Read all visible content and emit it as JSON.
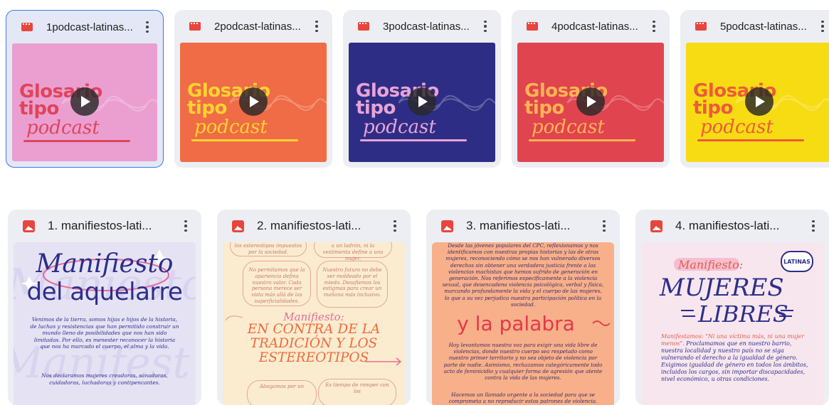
{
  "videos": [
    {
      "title": "1podcast-latinas...",
      "bg": "#ea9fd0",
      "title_color": "#e0445a",
      "podcast_color": "#e0445a",
      "line_color": "#e0445a",
      "selected": true
    },
    {
      "title": "2podcast-latinas...",
      "bg": "#ef6c46",
      "title_color": "#ffd330",
      "podcast_color": "#ffd330",
      "line_color": "#ffd330",
      "selected": false
    },
    {
      "title": "3podcast-latinas...",
      "bg": "#2e2d85",
      "title_color": "#e8a4d6",
      "podcast_color": "#e8a4d6",
      "line_color": "#e8a4d6",
      "selected": false
    },
    {
      "title": "4podcast-latinas...",
      "bg": "#e0444e",
      "title_color": "#ffb454",
      "podcast_color": "#ffb454",
      "line_color": "#ffb454",
      "selected": false
    },
    {
      "title": "5podcast-latinas...",
      "bg": "#f7dc13",
      "title_color": "#ee5a3a",
      "podcast_color": "#ee5a3a",
      "line_color": "#ee5a3a",
      "selected": false
    }
  ],
  "thumbnail_text": {
    "line1": "Glosario",
    "line2": "tipo",
    "line3": "podcast"
  },
  "images": [
    {
      "title": "1. manifiestos-lati...",
      "bg": "#e5e2f4",
      "heading1": "Manifiesto",
      "heading2": "del aquelarre",
      "para1": "Venimos de la tierra, somos hijas e hijos de la historia, de luchas y resistencias que han permitido construir un mundo lleno de posibilidades que nos han sido limitadas. Por ello, es menester reconocer la historia que nos ha marcado el cuerpo, el alma y la vida.",
      "para2": "Nos declaramos mujeres creadoras, sanadoras, cuidadoras, luchadoras y contipencantes."
    },
    {
      "title": "2. manifiestos-lati...",
      "bg": "#fbeccf",
      "bubble1": "los estereotipos impuestos por la sociedad.",
      "bubble2": "a un ladrón, ni la vestimenta define a una mujer.",
      "bubble3": "No permitamos que la apariencia defina nuestro valor. Cada persona merece ser vista más allá de las superficialidades.",
      "bubble4": "Nuestro futuro no debe ser moldeado por el miedo. Desafiemos los estigmas para crear un mañana más inclusivo.",
      "label": "Manifiesto:",
      "heading": "EN CONTRA DE LA TRADICIÓN Y LOS ESTEREOTIPOS",
      "bubble5": "Abogamos por un",
      "bubble6": "Es tiempo de romper con los"
    },
    {
      "title": "3. manifiestos-lati...",
      "bg": "#f7b089",
      "para1": "Desde las jóvenes populares del CPC, reflexionamos y nos identificamos con nuestras propias historias y las de otras mujeres, reconociendo cómo se nos han vulnerado diversos derechos sin obtener una verdadera justicia frente a las violencias machistas que hemos sufrido de generación en generación. Nos referimos específicamente a la violencia sexual, que desencadena violencia psicológica, verbal y física, marcando profundamente la vida y el cuerpo de las mujeres, lo que a su vez perjudica nuestra participación política en la sociedad.",
      "heading": "y la palabra",
      "para2": "Hoy levantamos nuestra voz para exigir una vida libre de violencias, donde nuestro cuerpo sea respetado como nuestro primer territorio y no sea objeto de violencia por parte de nadie. Asimismo, rechazamos categóricamente todo acto de feminicidio y cualquier forma de agresión que atente contra la vida de las mujeres.",
      "para3": "Hacemos un llamado urgente a la sociedad para que se comprometa a no reproducir estos patrones de violencia."
    },
    {
      "title": "4. manifiestos-lati...",
      "bg": "#f7e6ee",
      "badge": "LATINAS",
      "label": "Manifiesto:",
      "heading1": "MUJERES",
      "heading2": "LIBRES",
      "para1_quote": "Manifestamos: \"Ni una víctima más, ni una mujer menos\".",
      "para1_rest": " Proclamamos que en nuestro barrio, nuestra localidad y nuestro país no se siga vulnerando el derecho a la igualdad de género. Exigimos igualdad de género en todos los ámbitos, incluidos los cargos, sin importar discapacidades, nivel económico, u otras condiciones."
    }
  ]
}
